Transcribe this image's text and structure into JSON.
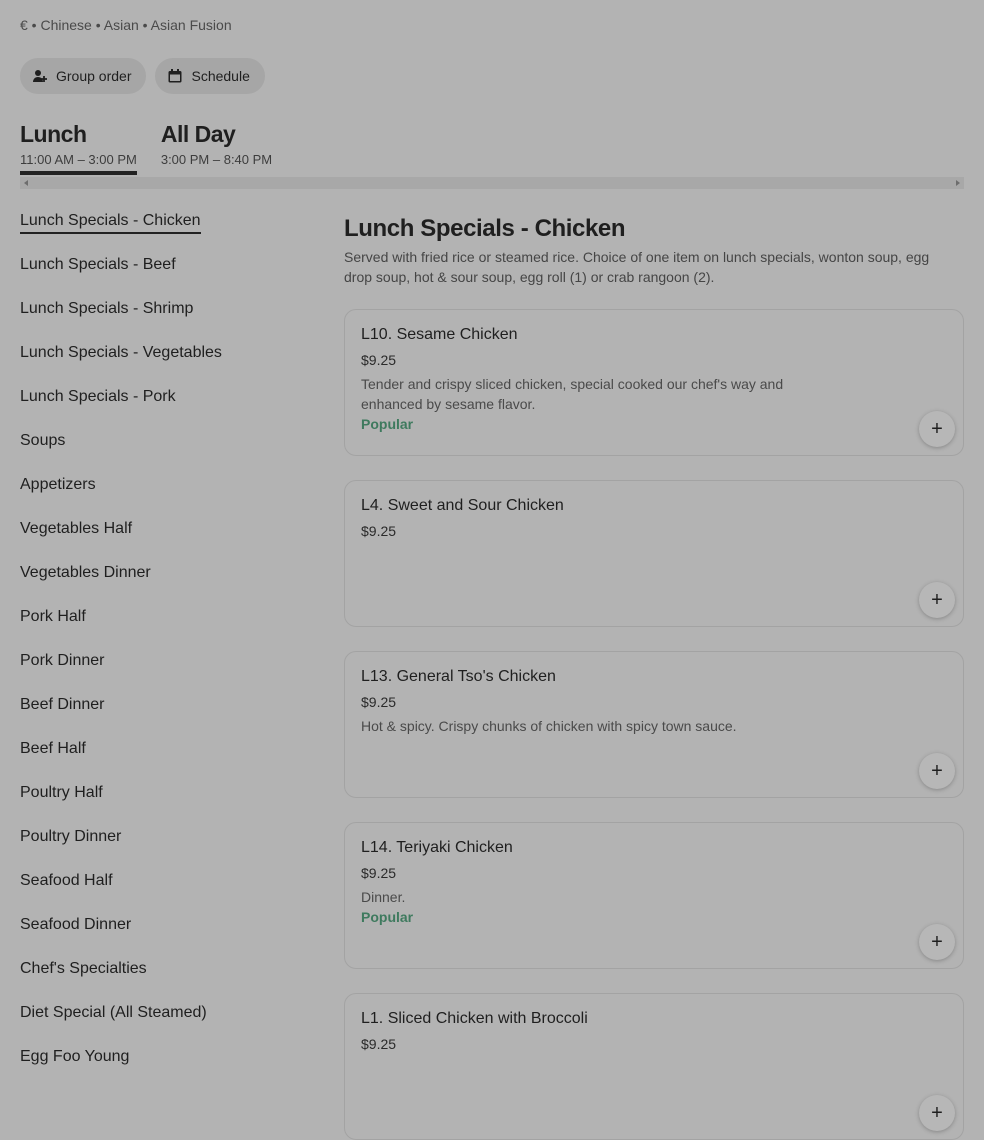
{
  "store": {
    "meta": "€ • Chinese • Asian • Asian Fusion"
  },
  "actions": {
    "group_order": "Group order",
    "schedule": "Schedule"
  },
  "menus": [
    {
      "name": "Lunch",
      "hours": "11:00 AM – 3:00 PM"
    },
    {
      "name": "All Day",
      "hours": "3:00 PM – 8:40 PM"
    }
  ],
  "categories": [
    "Lunch Specials - Chicken",
    "Lunch Specials - Beef",
    "Lunch Specials - Shrimp",
    "Lunch Specials - Vegetables",
    "Lunch Specials - Pork",
    "Soups",
    "Appetizers",
    "Vegetables Half",
    "Vegetables Dinner",
    "Pork Half",
    "Pork Dinner",
    "Beef Dinner",
    "Beef Half",
    "Poultry Half",
    "Poultry Dinner",
    "Seafood Half",
    "Seafood Dinner",
    "Chef's Specialties",
    "Diet Special (All Steamed)",
    "Egg Foo Young"
  ],
  "section": {
    "title": "Lunch Specials - Chicken",
    "description": "Served with fried rice or steamed rice. Choice of one item on lunch specials, wonton soup, egg drop soup, hot & sour soup, egg roll (1) or crab rangoon (2)."
  },
  "items": [
    {
      "title": "L10. Sesame Chicken",
      "price": "$9.25",
      "description": "Tender and crispy sliced chicken, special cooked our chef's way and enhanced by sesame flavor.",
      "tag": "Popular"
    },
    {
      "title": "L4. Sweet and Sour Chicken",
      "price": "$9.25",
      "description": "",
      "tag": ""
    },
    {
      "title": "L13. General Tso's Chicken",
      "price": "$9.25",
      "description": "Hot & spicy. Crispy chunks of chicken with spicy town sauce.",
      "tag": ""
    },
    {
      "title": "L14. Teriyaki Chicken",
      "price": "$9.25",
      "description": "Dinner.",
      "tag": "Popular"
    },
    {
      "title": "L1. Sliced Chicken with Broccoli",
      "price": "$9.25",
      "description": "",
      "tag": ""
    }
  ],
  "icons": {
    "group_order": "person-add-icon",
    "schedule": "calendar-icon",
    "add": "plus-icon"
  }
}
